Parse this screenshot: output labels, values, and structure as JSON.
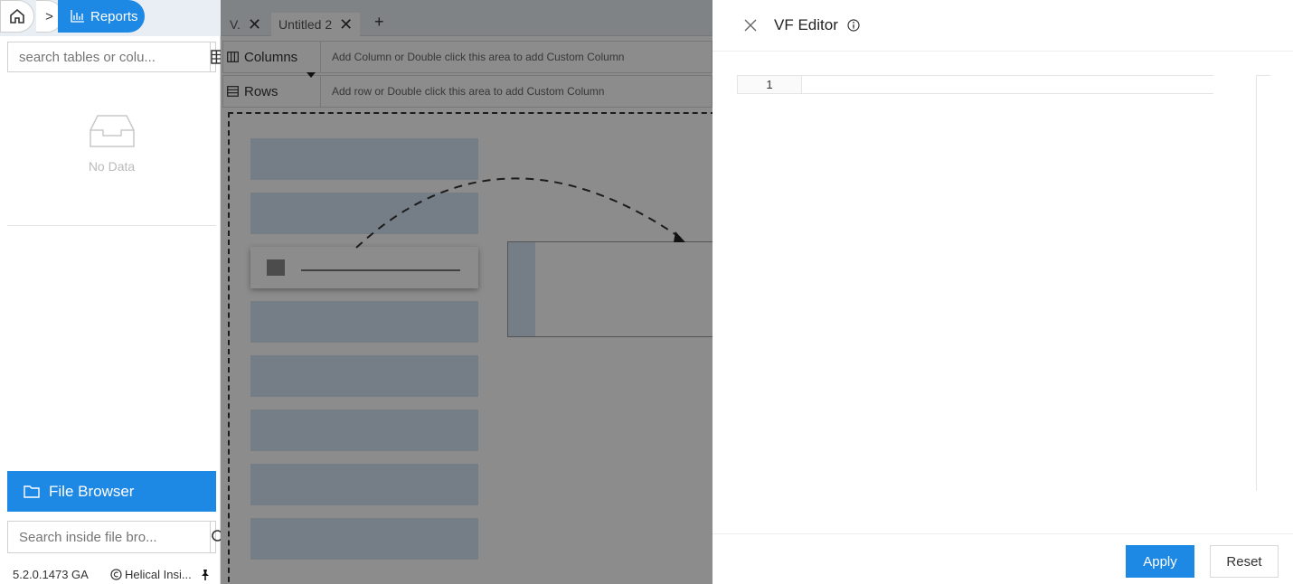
{
  "breadcrumb": {
    "reports_label": "Reports"
  },
  "sidebar": {
    "search_placeholder": "search tables or colu...",
    "empty_text": "No Data",
    "file_browser_label": "File Browser",
    "file_search_placeholder": "Search inside file bro...",
    "version": "5.2.0.1473 GA",
    "copyright": "Helical Insi..."
  },
  "tabs": [
    {
      "label": "V."
    },
    {
      "label": "Untitled 2"
    }
  ],
  "shelves": {
    "columns_label": "Columns",
    "columns_hint": "Add Column or Double click this area to add Custom Column",
    "rows_label": "Rows",
    "rows_hint": "Add row or Double click this area to add Custom Column"
  },
  "drawer": {
    "title": "VF Editor",
    "line_number": "1",
    "apply_label": "Apply",
    "reset_label": "Reset"
  },
  "colors": {
    "accent": "#1e88e5",
    "placeholder_fill": "#d6e6f4"
  }
}
